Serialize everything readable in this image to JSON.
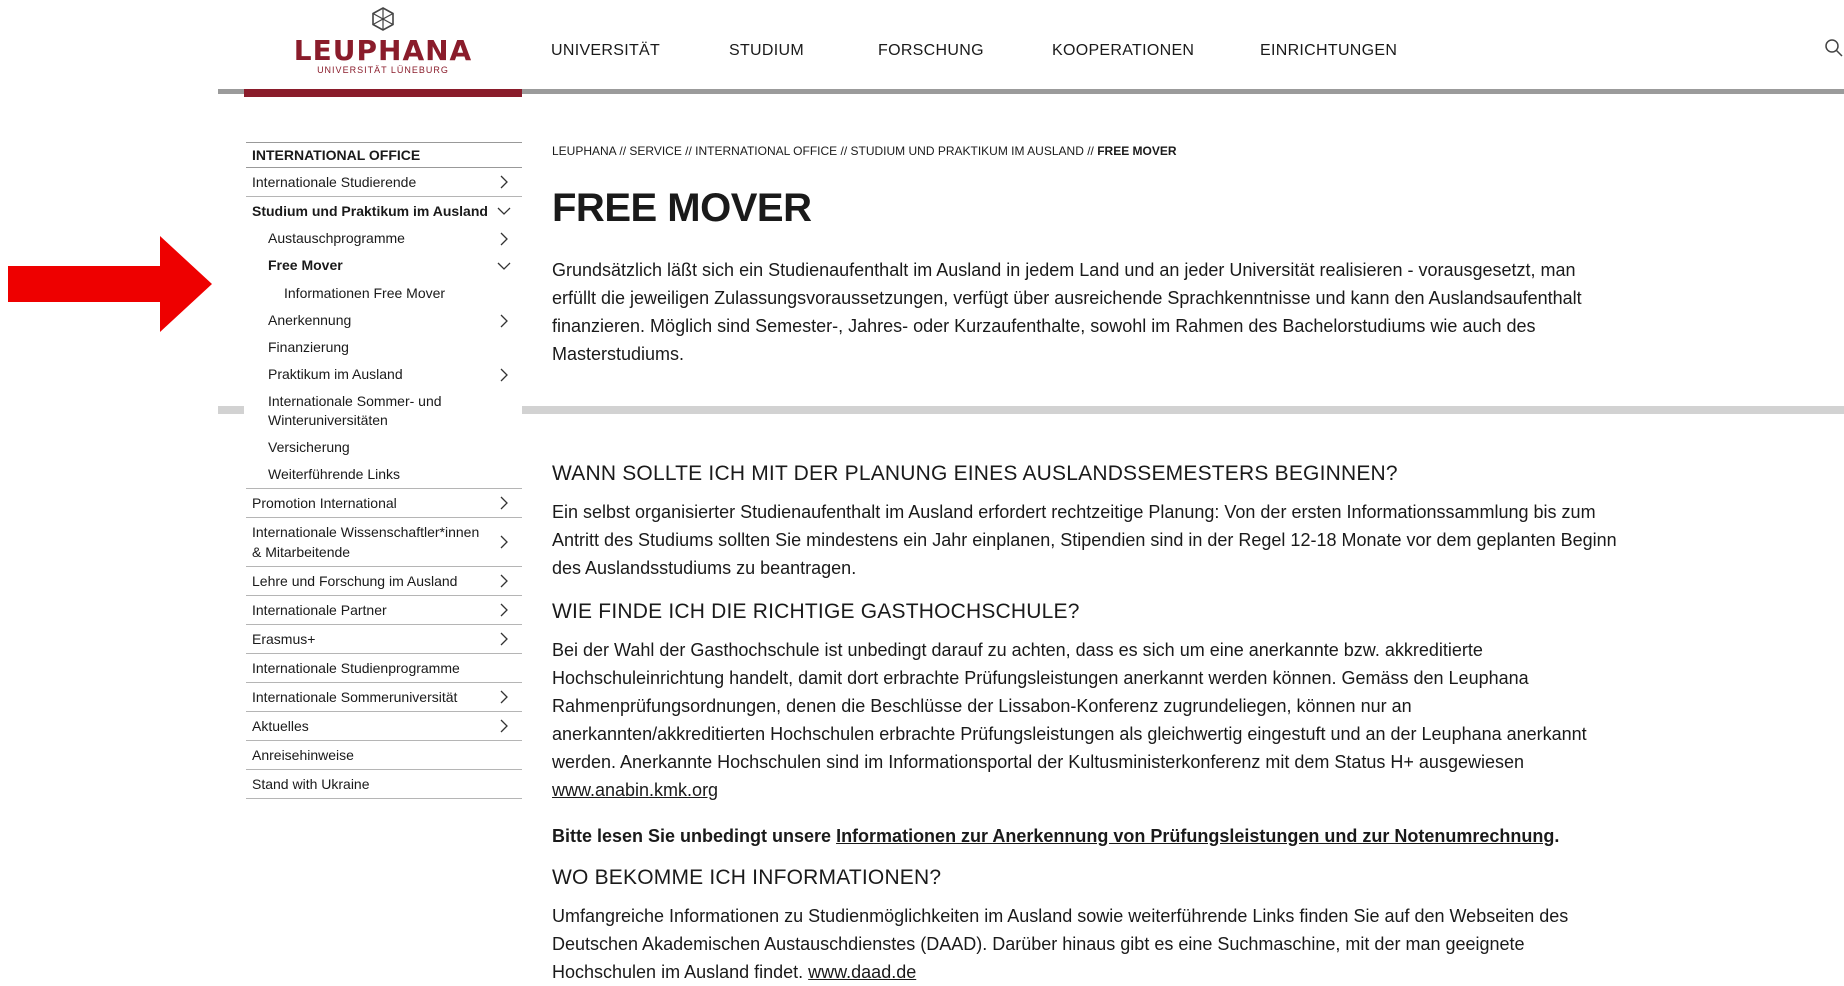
{
  "header": {
    "logo_main": "LEUPHANA",
    "logo_sub": "UNIVERSITÄT LÜNEBURG",
    "nav": [
      "UNIVERSITÄT",
      "STUDIUM",
      "FORSCHUNG",
      "KOOPERATIONEN",
      "EINRICHTUNGEN"
    ]
  },
  "sidebar": {
    "title": "INTERNATIONAL OFFICE",
    "items": [
      {
        "label": "Internationale Studierende"
      },
      {
        "label": "Studium und Praktikum im Ausland"
      },
      {
        "label": "Austauschprogramme"
      },
      {
        "label": "Free Mover"
      },
      {
        "label": "Informationen Free Mover"
      },
      {
        "label": "Anerkennung"
      },
      {
        "label": "Finanzierung"
      },
      {
        "label": "Praktikum im Ausland"
      },
      {
        "label": "Internationale Sommer- und Winteruniversitäten"
      },
      {
        "label": "Versicherung"
      },
      {
        "label": "Weiterführende Links"
      },
      {
        "label": "Promotion International"
      },
      {
        "label": "Internationale Wissenschaftler*innen & Mitarbeitende"
      },
      {
        "label": "Lehre und Forschung im Ausland"
      },
      {
        "label": "Internationale Partner"
      },
      {
        "label": "Erasmus+"
      },
      {
        "label": "Internationale Studienprogramme"
      },
      {
        "label": "Internationale Sommeruniversität"
      },
      {
        "label": "Aktuelles"
      },
      {
        "label": "Anreisehinweise"
      },
      {
        "label": "Stand with Ukraine"
      }
    ]
  },
  "breadcrumb": {
    "path": "LEUPHANA // SERVICE // INTERNATIONAL OFFICE // STUDIUM UND PRAKTIKUM IM AUSLAND // ",
    "current": "FREE MOVER"
  },
  "main": {
    "title": "FREE MOVER",
    "intro": [
      "Grundsätzlich läßt sich ein Studienaufenthalt im Ausland in jedem Land und an jeder Universität realisieren - vorausgesetzt, man",
      "erfüllt die jeweiligen Zulassungsvoraussetzungen, verfügt über ausreichende Sprachkenntnisse und kann den Auslandsaufenthalt",
      "finanzieren. Möglich sind Semester-, Jahres- oder Kurzaufenthalte, sowohl im Rahmen des Bachelorstudiums wie auch des",
      "Masterstudiums."
    ],
    "section1": {
      "heading": "Wann sollte ich mit der Planung eines Auslandssemesters beginnen?",
      "lines": [
        "Ein selbst organisierter Studienaufenthalt im Ausland erfordert rechtzeitige Planung: Von der ersten Informationssammlung bis zum",
        "Antritt des Studiums sollten Sie mindestens ein Jahr einplanen, Stipendien sind in der Regel 12-18 Monate vor dem geplanten Beginn",
        "des Auslandsstudiums zu beantragen."
      ]
    },
    "section2": {
      "heading": "Wie finde ich die richtige Gasthochschule?",
      "lines": [
        "Bei der Wahl der Gasthochschule ist unbedingt darauf zu achten, dass es sich um eine anerkannte bzw. akkreditierte",
        "Hochschuleinrichtung handelt, damit dort erbrachte Prüfungsleistungen anerkannt werden können. Gemäss den Leuphana",
        "Rahmenprüfungsordnungen, denen die Beschlüsse der Lissabon-Konferenz zugrundeliegen, können nur an",
        "anerkannten/akkreditierten Hochschulen erbrachte Prüfungsleistungen als gleichwertig eingestuft und an der Leuphana anerkannt",
        "werden. Anerkannte Hochschulen sind im Informationsportal der Kultusministerkonferenz mit dem Status H+ ausgewiesen"
      ],
      "link": "www.anabin.kmk.org",
      "notice_prefix": "Bitte lesen Sie unbedingt unsere ",
      "notice_link": "Informationen zur Anerkennung von Prüfungsleistungen und zur Notenumrechnung",
      "notice_suffix": "."
    },
    "section3": {
      "heading": "Wo bekomme ich Informationen?",
      "lines": [
        "Umfangreiche Informationen zu Studienmöglichkeiten im Ausland sowie weiterführende Links finden Sie auf den Webseiten des",
        "Deutschen Akademischen Austauschdienstes (DAAD). Darüber hinaus gibt es eine Suchmaschine, mit der man geeignete",
        "Hochschulen im Ausland findet. "
      ],
      "link": "www.daad.de"
    }
  },
  "colors": {
    "brand": "#8a1c2b",
    "arrow": "#ee0000"
  },
  "icons": {
    "search": "search-icon",
    "chevron_right": "chevron-right-icon",
    "chevron_down": "chevron-down-icon",
    "logo": "cube-logo-icon"
  }
}
